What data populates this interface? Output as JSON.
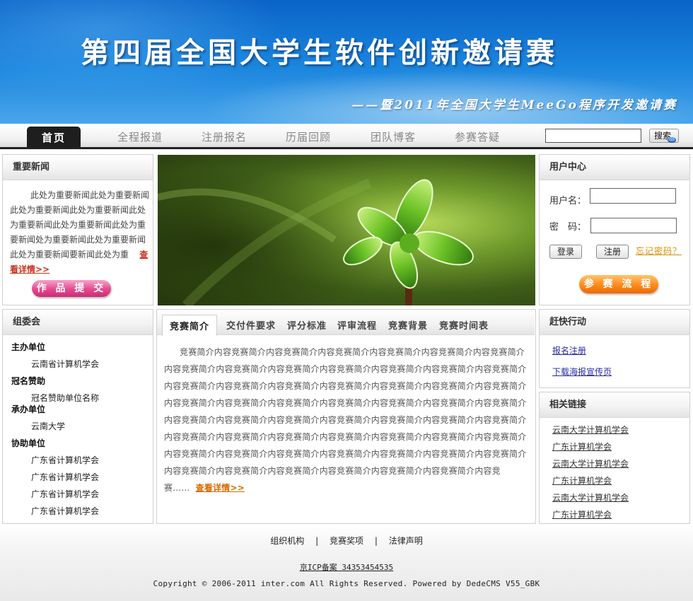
{
  "banner": {
    "title": "第四届全国大学生软件创新邀请赛",
    "subtitle": "——暨2011年全国大学生MeeGo程序开发邀请赛"
  },
  "nav": {
    "items": [
      "首页",
      "全程报道",
      "注册报名",
      "历届回顾",
      "团队博客",
      "参赛答疑"
    ],
    "search_value": "",
    "search_button": "搜索"
  },
  "news": {
    "title": "重要新闻",
    "text": "此处为重要新闻此处为重要新闻此处为重要新闻此处为重要新闻此处为重要新闻此处为重要新闻此处为重要新闻处为重要新闻此处为重要新闻此处为重要新闻要新闻此处为重",
    "more": "查看详情>>",
    "submit_button": "作 品 提 交"
  },
  "user_center": {
    "title": "用户中心",
    "username_label": "用户名：",
    "password_label": "密　码：",
    "login_button": "登录",
    "register_button": "注册",
    "forgot": "忘记密码？",
    "flow_button": "参 赛 流 程"
  },
  "committee": {
    "title": "组委会",
    "rows": [
      {
        "type": "head",
        "text": "主办单位"
      },
      {
        "type": "sub",
        "text": "云南省计算机学会"
      },
      {
        "type": "head",
        "text": "冠名赞助"
      },
      {
        "type": "sub",
        "text": "冠名赞助单位名称"
      },
      {
        "type": "head",
        "text": "承办单位"
      },
      {
        "type": "sub",
        "text": "云南大学"
      },
      {
        "type": "head",
        "text": "协助单位"
      },
      {
        "type": "sub",
        "text": "广东省计算机学会"
      },
      {
        "type": "sub",
        "text": "广东省计算机学会"
      },
      {
        "type": "sub",
        "text": "广东省计算机学会"
      },
      {
        "type": "sub",
        "text": "广东省计算机学会"
      }
    ]
  },
  "contest": {
    "tabs": [
      "竞赛简介",
      "交付件要求",
      "评分标准",
      "评审流程",
      "竞赛背景",
      "竞赛时间表"
    ],
    "intro": "竞赛简介内容竞赛简介内容竞赛简介内容竞赛简介内容竞赛简介内容竞赛简介内容竞赛简介内容竞赛简介内容竞赛简介内容竞赛简介内容竞赛简介内容竞赛简介内容竞赛简介内容竞赛简介内容竞赛简介内容竞赛简介内容竞赛简介内容竞赛简介内容竞赛简介内容竞赛简介内容竞赛简介内容竞赛简介内容竞赛简介内容竞赛简介内容竞赛简介内容竞赛简介内容竞赛简介内容竞赛简介内容竞赛简介内容竞赛简介内容竞赛简介内容竞赛简介内容竞赛简介内容竞赛简介内容竞赛简介内容竞赛简介内容竞赛简介内容竞赛简介内容竞赛简介内容竞赛简介内容竞赛简介内容竞赛简介内容竞赛简介内容竞赛简介内容竞赛简介内容竞赛简介内容竞赛简介内容竞赛简介内容竞赛简介内容竞赛简介内容竞赛简介内容竞赛简介内容竞赛简介内容竞赛简介内容竞赛简介内容竞赛……",
    "more": "查看详情>>"
  },
  "quick_actions": {
    "title": "赶快行动",
    "links": [
      "报名注册",
      "下载海报宣传页"
    ]
  },
  "related_links": {
    "title": "相关链接",
    "links": [
      "云南大学计算机学会",
      "广东计算机学会",
      "云南大学计算机学会",
      "广东计算机学会",
      "云南大学计算机学会",
      "广东计算机学会"
    ]
  },
  "footer": {
    "links": [
      "组织机构",
      "竞赛奖项",
      "法律声明"
    ],
    "separator": "|",
    "icp": "京ICP备案 34353454535",
    "copyright": "Copyright © 2006-2011 inter.com All Rights Reserved. Powered by DedeCMS V55_GBK"
  }
}
